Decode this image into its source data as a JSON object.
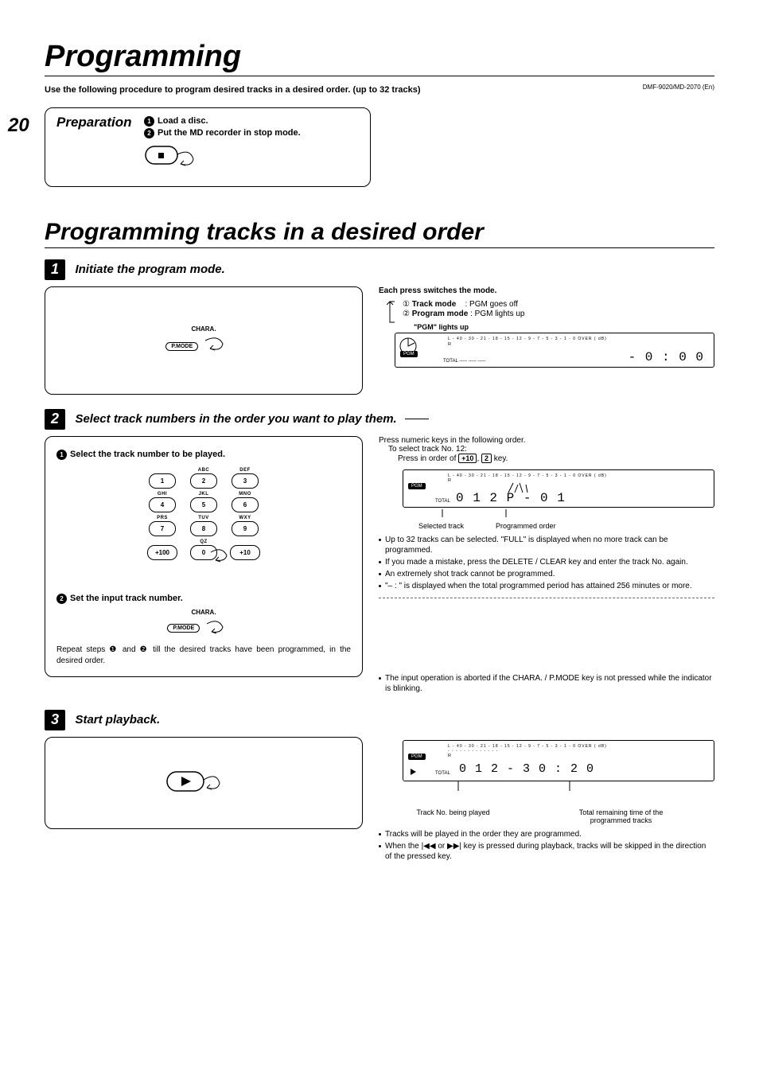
{
  "header": {
    "title": "Programming",
    "code": "DMF-9020/MD-2070 (En)"
  },
  "page_number": "20",
  "intro": "Use the following procedure to program desired tracks in a desired order. (up to 32 tracks)",
  "prep": {
    "title": "Preparation",
    "s1": "Load a disc.",
    "s2": "Put the MD recorder in stop mode."
  },
  "h2": "Programming tracks in a desired order",
  "step1": {
    "title": "Initiate the program mode.",
    "modeHeading": "Each press switches the mode.",
    "m1a": "Track mode",
    "m1b": ": PGM goes off",
    "m2a": "Program mode",
    "m2b": ": PGM lights up",
    "pgmLights": "\"PGM\" lights up",
    "pgm": "PGM",
    "scale": "L    - 40  - 30  - 21  - 18  - 15  - 12  -  9  -  7  -  5  -  3  -  1  -  0  OVER ( dB)",
    "total": "TOTAL  -----  -----  -----",
    "time": "- 0 : 0 0",
    "chara": "CHARA.",
    "pmode": "P.MODE"
  },
  "step2": {
    "title": "Select track numbers in the order you want to play them.",
    "sub1": "Select the track number to be played.",
    "sub2": "Set the input track number.",
    "repeat": "Repeat steps ❶ and ❷ till the desired tracks have been programmed, in the desired order.",
    "keys": {
      "abc": "ABC",
      "def": "DEF",
      "ghi": "GHI",
      "jkl": "JKL",
      "mno": "MNO",
      "prs": "PRS",
      "tuv": "TUV",
      "wxy": "WXY",
      "qz": "QZ",
      "k1": "1",
      "k2": "2",
      "k3": "3",
      "k4": "4",
      "k5": "5",
      "k6": "6",
      "k7": "7",
      "k8": "8",
      "k9": "9",
      "k0": "0",
      "kp100": "+100",
      "kp10": "+10"
    },
    "right": {
      "l1": "Press numeric keys in the following order.",
      "l2": "To select track No. 12:",
      "l3a": "Press in order of ",
      "l3key1": "+10",
      "l3mid": ", ",
      "l3key2": "2",
      "l3b": " key.",
      "scale": "L    - 40  - 30  - 21  - 18  - 15  - 12  -  9  -  7  -  5  -  3  -  1  -  0  OVER ( dB)",
      "total": "TOTAL",
      "disp": "0 1 2        P - 0 1",
      "c1": "Selected track",
      "c2": "Programmed order",
      "b1": "Up to 32 tracks can be selected. \"FULL\" is displayed when no more track can be programmed.",
      "b2": "If you made a mistake, press the DELETE / CLEAR key and enter the track No. again.",
      "b3": "An extremely shot track cannot be programmed.",
      "b4": "\"–   :   \" is displayed when the total programmed period has attained 256 minutes or more.",
      "note": "The input operation is aborted if the CHARA. / P.MODE key is not pressed while the indicator is blinking."
    },
    "chara": "CHARA.",
    "pmode": "P.MODE"
  },
  "step3": {
    "title": "Start playback.",
    "scale": "L    - 40  - 30  - 21  - 18  - 15  - 12  -  9  -  7  -  5  -  3  -  1  -  0  OVER ( dB)",
    "total": "TOTAL",
    "disp": "0 1 2   - 3 0 : 2 0",
    "c1": "Track No. being played",
    "c2": "Total remaining time of the programmed tracks",
    "b1": "Tracks will be played in the order they are programmed.",
    "b2": "When the |◀◀ or ▶▶| key is pressed during playback, tracks will be skipped in the direction of the pressed key."
  }
}
